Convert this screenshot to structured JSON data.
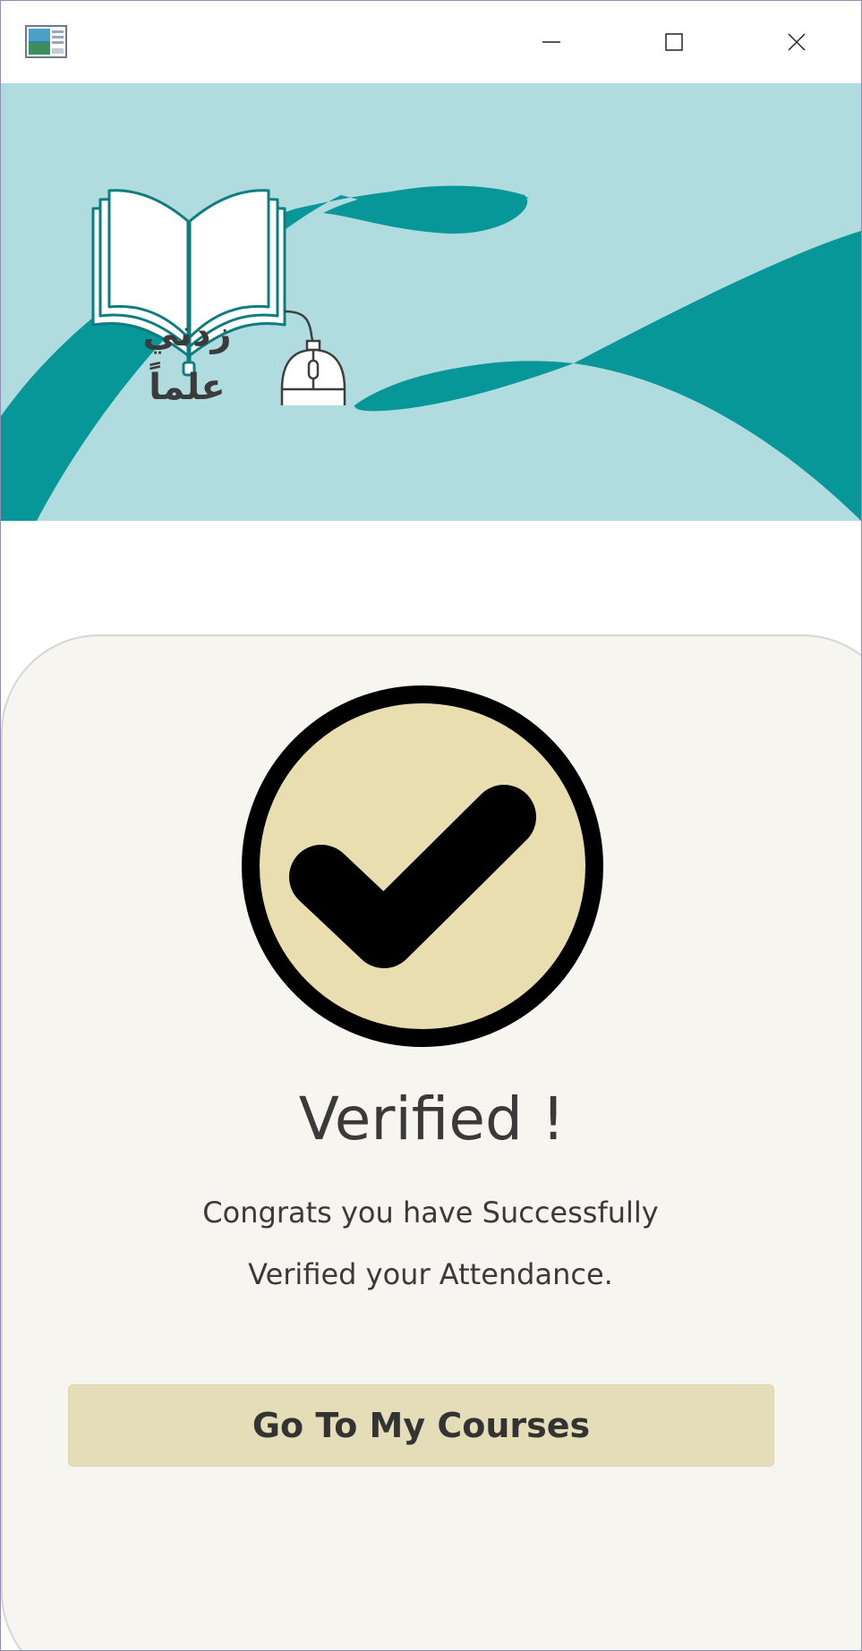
{
  "titlebar": {
    "icons": {
      "app": "app-window-icon",
      "minimize": "minimize-icon",
      "maximize": "maximize-icon",
      "close": "close-icon"
    }
  },
  "banner": {
    "logo_text": "زدني علماً",
    "icons": {
      "book": "open-book-icon",
      "mouse": "computer-mouse-icon"
    },
    "colors": {
      "background": "#b1dcdf",
      "accent": "#079798"
    }
  },
  "verification": {
    "icon": "check-circle-icon",
    "title": "Verified !",
    "message_line1": "Congrats you have Successfully",
    "message_line2": "Verified your Attendance.",
    "button_label": "Go To My Courses",
    "colors": {
      "card_background": "#f6f5ef",
      "circle_fill": "#e8deb0",
      "button_background": "#e5ddb7"
    }
  }
}
